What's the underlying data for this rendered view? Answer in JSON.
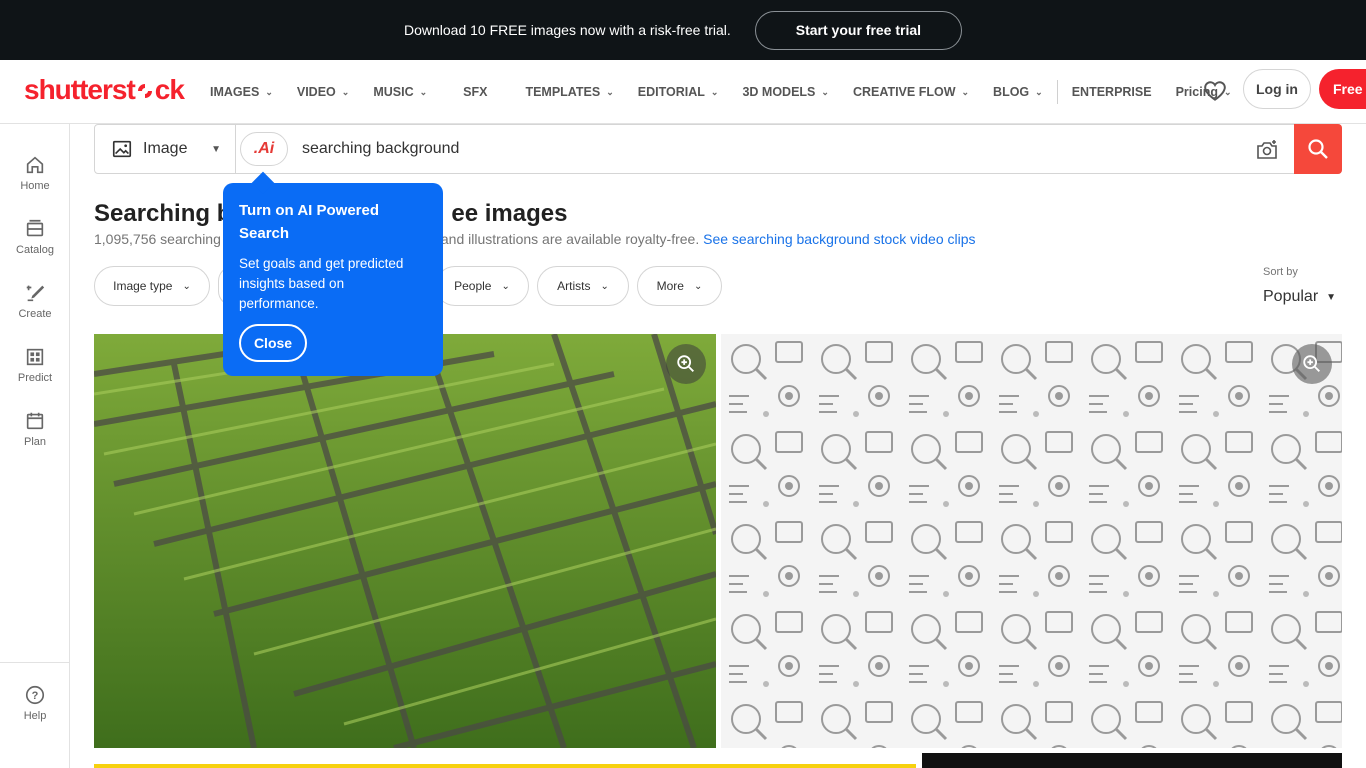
{
  "promo": {
    "text": "Download 10 FREE images now with a risk-free trial.",
    "cta": "Start your free trial"
  },
  "brand": {
    "logo_text_a": "shutterst",
    "logo_text_b": "ck"
  },
  "nav": {
    "items": [
      {
        "label": "IMAGES",
        "has_menu": true
      },
      {
        "label": "VIDEO",
        "has_menu": true
      },
      {
        "label": "MUSIC",
        "has_menu": true
      },
      {
        "label": "SFX",
        "has_menu": false
      },
      {
        "label": "TEMPLATES",
        "has_menu": true
      },
      {
        "label": "EDITORIAL",
        "has_menu": true
      },
      {
        "label": "3D MODELS",
        "has_menu": true
      },
      {
        "label": "CREATIVE FLOW",
        "has_menu": true
      },
      {
        "label": "BLOG",
        "has_menu": true
      }
    ],
    "enterprise": "ENTERPRISE",
    "pricing": "Pricing",
    "login": "Log in",
    "free_trial": "Free t"
  },
  "rail": {
    "home": "Home",
    "catalog": "Catalog",
    "create": "Create",
    "predict": "Predict",
    "plan": "Plan",
    "help": "Help"
  },
  "search": {
    "type_label": "Image",
    "ai_badge": ".Ai",
    "query": "searching background"
  },
  "results": {
    "title": "Searching background royalty-free images",
    "title_visible_left": "Searching b",
    "title_visible_right": "ee images",
    "count_text_left": "1,095,756 searching",
    "count_text_right": "and illustrations are available royalty-free.",
    "video_link": "See searching background stock video clips"
  },
  "filters": {
    "image_type": "Image type",
    "people": "People",
    "artists": "Artists",
    "more": "More",
    "sort_label": "Sort by",
    "sort_value": "Popular"
  },
  "tooltip": {
    "title": "Turn on AI Powered Search",
    "body": "Set goals and get predicted insights based on performance.",
    "close": "Close"
  },
  "colors": {
    "brand_red": "#f5222d",
    "tooltip_blue": "#0a6cf5",
    "link_blue": "#1a73e8",
    "banner_dark": "#0f1417"
  }
}
